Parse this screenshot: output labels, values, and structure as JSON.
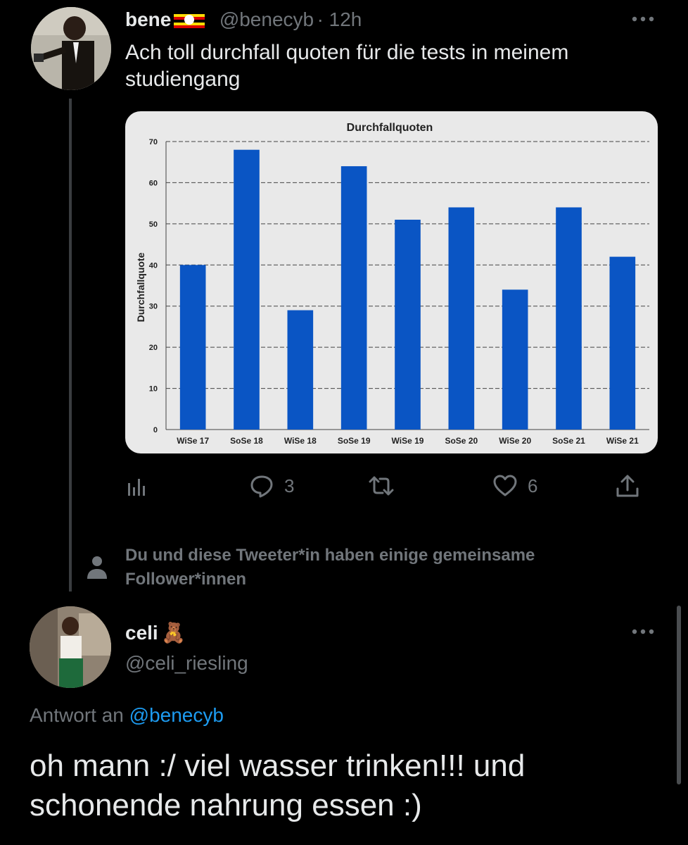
{
  "tweet": {
    "author_name": "bene",
    "author_handle": "@benecyb",
    "timestamp": "· 12h",
    "text": "Ach toll durchfall quoten für die tests in meinem studiengang",
    "replies_count": "3",
    "likes_count": "6",
    "more_icon": "more-dots-icon"
  },
  "chart_data": {
    "type": "bar",
    "title": "Durchfallquoten",
    "xlabel": "",
    "ylabel": "Durchfallquote",
    "categories": [
      "WiSe 17",
      "SoSe 18",
      "WiSe 18",
      "SoSe 19",
      "WiSe 19",
      "SoSe 20",
      "WiSe 20",
      "SoSe 21",
      "WiSe 21"
    ],
    "values": [
      40,
      68,
      29,
      64,
      51,
      54,
      34,
      54,
      42
    ],
    "ylim": [
      0,
      70
    ],
    "yticks": [
      0,
      10,
      20,
      30,
      40,
      50,
      60,
      70
    ],
    "bar_color": "#0a55c4",
    "grid": true
  },
  "mutual_followers": {
    "text": "Du und diese Tweeter*in haben einige gemeinsame Follower*innen",
    "icon": "person-icon"
  },
  "reply": {
    "author_name": "celi",
    "author_emoji": "🧸",
    "author_handle": "@celi_riesling",
    "reply_to_prefix": "Antwort an",
    "reply_to_handle": "@benecyb",
    "text": "oh mann :/ viel wasser trinken!!! und schonende nahrung essen :)"
  },
  "colors": {
    "background": "#000000",
    "text": "#e7e9ea",
    "secondary": "#71767b",
    "link": "#1d9bf0"
  }
}
